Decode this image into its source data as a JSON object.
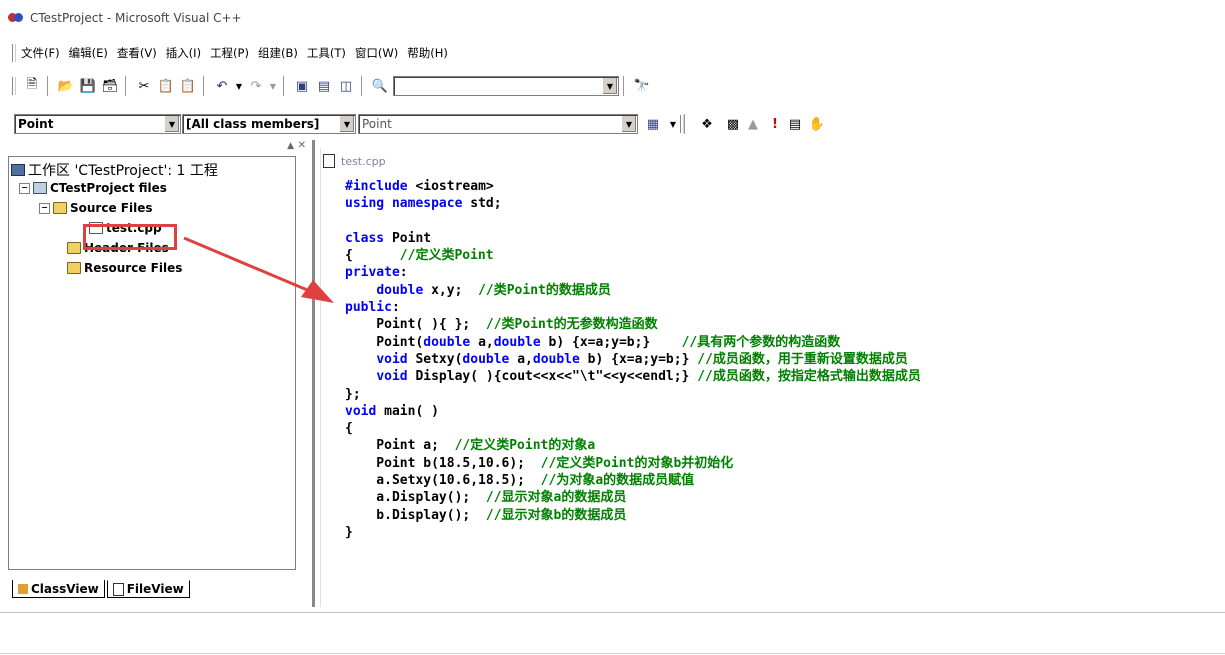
{
  "window": {
    "title": "CTestProject - Microsoft Visual C++"
  },
  "menu": [
    "文件(F)",
    "编辑(E)",
    "查看(V)",
    "插入(I)",
    "工程(P)",
    "组建(B)",
    "工具(T)",
    "窗口(W)",
    "帮助(H)"
  ],
  "toolbar": {
    "find_combo_value": "",
    "class_combo": "Point",
    "filter_combo": "[All class members]",
    "member_combo": "Point"
  },
  "workspace": {
    "root": "工作区 'CTestProject': 1 工程",
    "project": "CTestProject files",
    "source_folder": "Source Files",
    "source_file": "test.cpp",
    "header_folder": "Header Files",
    "resource_folder": "Resource Files",
    "tab_classview": "ClassView",
    "tab_fileview": "FileView"
  },
  "editor": {
    "tab": "test.cpp",
    "lines": [
      [
        [
          "kw",
          "#include"
        ],
        [
          "t",
          " <iostream>"
        ]
      ],
      [
        [
          "kw",
          "using"
        ],
        [
          "t",
          " "
        ],
        [
          "kw",
          "namespace"
        ],
        [
          "t",
          " std;"
        ]
      ],
      [
        [
          "t",
          ""
        ]
      ],
      [
        [
          "kw",
          "class"
        ],
        [
          "t",
          " Point"
        ]
      ],
      [
        [
          "t",
          "{      "
        ],
        [
          "cm",
          "//定义类Point"
        ]
      ],
      [
        [
          "kw",
          "private"
        ],
        [
          "t",
          ":"
        ]
      ],
      [
        [
          "t",
          "    "
        ],
        [
          "kw",
          "double"
        ],
        [
          "t",
          " x,y;  "
        ],
        [
          "cm",
          "//类Point的数据成员"
        ]
      ],
      [
        [
          "kw",
          "public"
        ],
        [
          "t",
          ":"
        ]
      ],
      [
        [
          "t",
          "    Point( ){ };  "
        ],
        [
          "cm",
          "//类Point的无参数构造函数"
        ]
      ],
      [
        [
          "t",
          "    Point("
        ],
        [
          "kw",
          "double"
        ],
        [
          "t",
          " a,"
        ],
        [
          "kw",
          "double"
        ],
        [
          "t",
          " b) {x=a;y=b;}    "
        ],
        [
          "cm",
          "//具有两个参数的构造函数"
        ]
      ],
      [
        [
          "t",
          "    "
        ],
        [
          "kw",
          "void"
        ],
        [
          "t",
          " Setxy("
        ],
        [
          "kw",
          "double"
        ],
        [
          "t",
          " a,"
        ],
        [
          "kw",
          "double"
        ],
        [
          "t",
          " b) {x=a;y=b;} "
        ],
        [
          "cm",
          "//成员函数，用于重新设置数据成员"
        ]
      ],
      [
        [
          "t",
          "    "
        ],
        [
          "kw",
          "void"
        ],
        [
          "t",
          " Display( ){cout<<x<<\"\\t\"<<y<<endl;} "
        ],
        [
          "cm",
          "//成员函数，按指定格式输出数据成员"
        ]
      ],
      [
        [
          "t",
          "};"
        ]
      ],
      [
        [
          "kw",
          "void"
        ],
        [
          "t",
          " main( )"
        ]
      ],
      [
        [
          "t",
          "{"
        ]
      ],
      [
        [
          "t",
          "    Point a;  "
        ],
        [
          "cm",
          "//定义类Point的对象a"
        ]
      ],
      [
        [
          "t",
          "    Point b(18.5,10.6);  "
        ],
        [
          "cm",
          "//定义类Point的对象b并初始化"
        ]
      ],
      [
        [
          "t",
          "    a.Setxy(10.6,18.5);  "
        ],
        [
          "cm",
          "//为对象a的数据成员赋值"
        ]
      ],
      [
        [
          "t",
          "    a.Display();  "
        ],
        [
          "cm",
          "//显示对象a的数据成员"
        ]
      ],
      [
        [
          "t",
          "    b.Display();  "
        ],
        [
          "cm",
          "//显示对象b的数据成员"
        ]
      ],
      [
        [
          "t",
          "}"
        ]
      ]
    ]
  },
  "colors": {
    "keyword": "#0000ff",
    "comment": "#008000",
    "annotation": "#e04040"
  }
}
